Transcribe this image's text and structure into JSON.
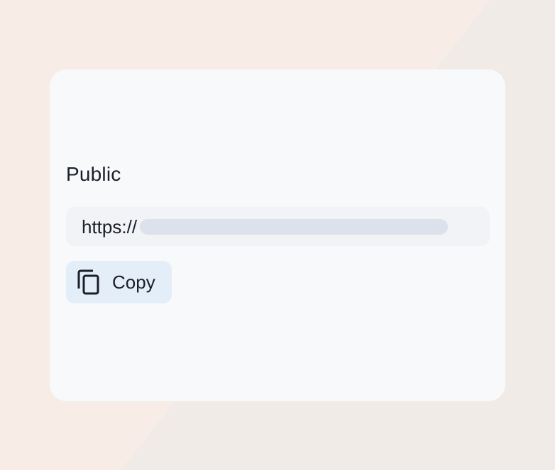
{
  "share": {
    "section_title": "Public",
    "url_prefix": "https://",
    "copy_label": "Copy"
  },
  "icons": {
    "copy": "copy-icon"
  },
  "colors": {
    "background": "#f8ece6",
    "card": "#f7f9fb",
    "field": "#f1f3f6",
    "button": "#e3eef9",
    "text": "#1b1f27",
    "redacted": "#dde1ec"
  }
}
